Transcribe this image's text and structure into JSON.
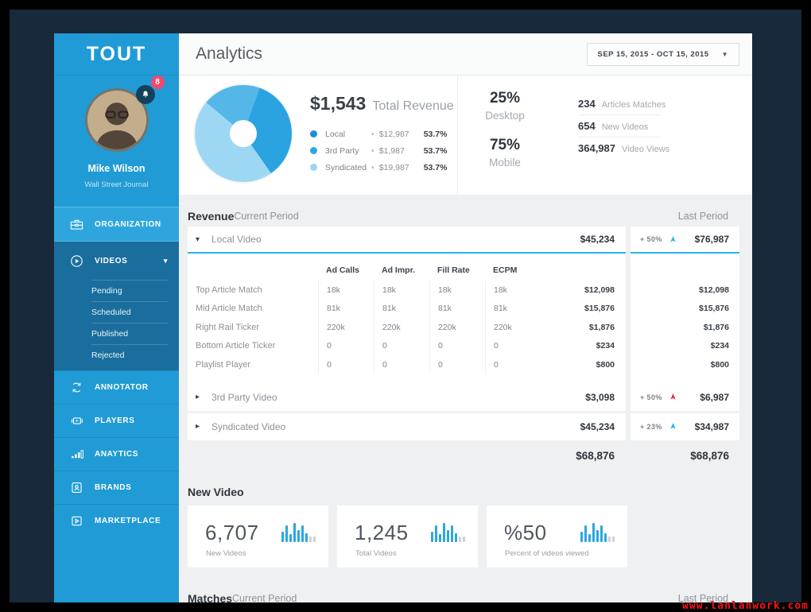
{
  "colors": {
    "page_bg": "#17293a",
    "content_bg": "#eef0f1",
    "sidebar": "#209bd5",
    "sidebar_highlight": "#2ea6dd",
    "sidebar_active": "#1a6e9d",
    "row_underline": "#2bb3ef",
    "trend_up": "#2bb3ef",
    "trend_down": "#e8274b",
    "badge_pink": "#f5476d"
  },
  "sidebar": {
    "logo": "TOUT",
    "profile": {
      "name": "Mike Wilson",
      "org": "Wall Street Journal",
      "notification_count": "8"
    },
    "organization_label": "ORGANIZATION",
    "videos": {
      "label": "VIDEOS",
      "caret": "▾",
      "sub_items": [
        {
          "label": "Pending"
        },
        {
          "label": "Scheduled"
        },
        {
          "label": "Published"
        },
        {
          "label": "Rejected"
        }
      ]
    },
    "items": [
      {
        "label": "ANNOTATOR"
      },
      {
        "label": "PLAYERS"
      },
      {
        "label": "ANAYTICS"
      },
      {
        "label": "BRANDS"
      },
      {
        "label": "MARKETPLACE"
      }
    ]
  },
  "header": {
    "title": "Analytics",
    "date_range": "SEP 15, 2015  -  OCT 15, 2015",
    "date_caret": "▼"
  },
  "summary": {
    "total_revenue_value": "$1,543",
    "total_revenue_label": "Total Revenue",
    "legend": [
      {
        "name": "Local",
        "sep": "•",
        "amount": "$12,987",
        "pct": "53.7%",
        "color": "#1e8fd5"
      },
      {
        "name": "3rd Party",
        "sep": "•",
        "amount": "$1,987",
        "pct": "53.7%",
        "color": "#2ba7e2"
      },
      {
        "name": "Syndicated",
        "sep": "•",
        "amount": "$19,987",
        "pct": "53.7%",
        "color": "#9bd5f2"
      }
    ],
    "devices": [
      {
        "value": "25%",
        "label": "Desktop"
      },
      {
        "value": "75%",
        "label": "Mobile"
      }
    ],
    "quick_stats": [
      {
        "value": "234",
        "label": "Articles Matches"
      },
      {
        "value": "654",
        "label": "New Videos"
      },
      {
        "value": "364,987",
        "label": "Video Views"
      }
    ]
  },
  "chart_data": {
    "type": "pie",
    "title": "Total Revenue",
    "series": [
      {
        "name": "Local",
        "value": 12987,
        "pct": "53.7%"
      },
      {
        "name": "3rd Party",
        "value": 1987,
        "pct": "53.7%"
      },
      {
        "name": "Syndicated",
        "value": 19987,
        "pct": "53.7%"
      }
    ],
    "donut": {
      "base": 20,
      "segments": [
        {
          "color": "#2aa3e0",
          "from": 0,
          "to": 125
        },
        {
          "color": "#9ed7f4",
          "from": 125,
          "to": 290
        },
        {
          "color": "#55b7e8",
          "from": 290,
          "to": 360
        }
      ]
    }
  },
  "revenue": {
    "title": "Revenue",
    "col_current": "Current Period",
    "col_last": "Last Period",
    "rows": [
      {
        "caret": "▾",
        "label": "Local Video",
        "current": "$45,234",
        "change": "+ 50%",
        "trend": "up",
        "last": "$76,987"
      },
      {
        "caret": "▸",
        "label": "3rd Party Video",
        "current": "$3,098",
        "change": "+ 50%",
        "trend": "down",
        "last": "$6,987"
      },
      {
        "caret": "▸",
        "label": "Syndicated Video",
        "current": "$45,234",
        "change": "+ 23%",
        "trend": "up",
        "last": "$34,987"
      }
    ],
    "detail": {
      "columns": [
        "Ad Calls",
        "Ad Impr.",
        "Fill Rate",
        "ECPM"
      ],
      "rows": [
        {
          "label": "Top Article Match",
          "values": [
            "18k",
            "18k",
            "18k",
            "18k"
          ],
          "amount": "$12,098",
          "last": "$12,098"
        },
        {
          "label": "Mid Article Match",
          "values": [
            "81k",
            "81k",
            "81k",
            "81k"
          ],
          "amount": "$15,876",
          "last": "$15,876"
        },
        {
          "label": "Right Rail Ticker",
          "values": [
            "220k",
            "220k",
            "220k",
            "220k"
          ],
          "amount": "$1,876",
          "last": "$1,876"
        },
        {
          "label": "Bottom Article Ticker",
          "values": [
            "0",
            "0",
            "0",
            "0"
          ],
          "amount": "$234",
          "last": "$234"
        },
        {
          "label": "Playlist Player",
          "values": [
            "0",
            "0",
            "0",
            "0"
          ],
          "amount": "$800",
          "last": "$800"
        }
      ]
    },
    "total_current": "$68,876",
    "total_last": "$68,876"
  },
  "new_video": {
    "title": "New Video",
    "cards": [
      {
        "value": "6,707",
        "label": "New Videos"
      },
      {
        "value": "1,245",
        "label": "Total Videos"
      },
      {
        "value": "%50",
        "label": "Percent of videos viewed"
      }
    ],
    "sparkline": {
      "values": [
        13,
        21,
        10,
        24,
        15,
        21,
        11,
        7,
        7
      ],
      "bar_color": "#2ba7e2",
      "muted_color": "#ccd2d6",
      "muted_from": 7
    }
  },
  "matches": {
    "title": "Matches",
    "col_current": "Current Period",
    "col_last": "Last Period"
  },
  "watermark": "www.lanlanwork.com"
}
